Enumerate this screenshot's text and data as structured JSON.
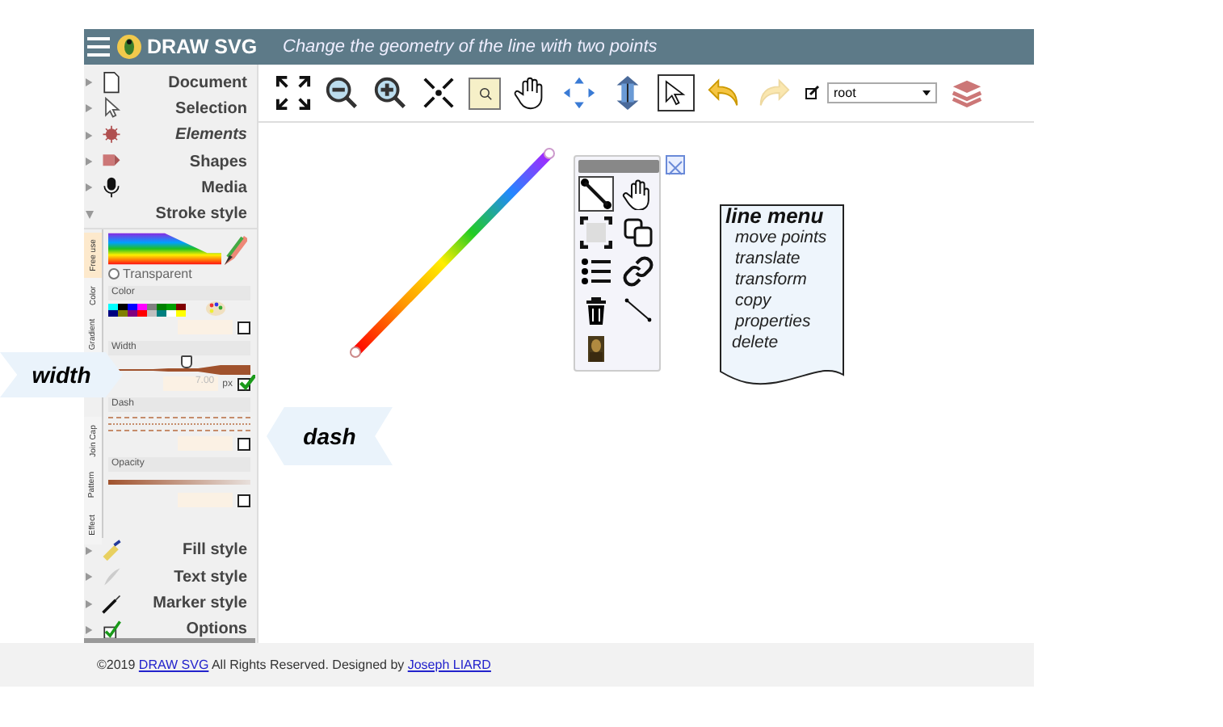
{
  "header": {
    "title": "DRAW SVG",
    "subtitle": "Change the geometry of the line with two points"
  },
  "sidebar": {
    "items": [
      {
        "label": "Document",
        "expanded": false,
        "emphasized": false
      },
      {
        "label": "Selection",
        "expanded": false,
        "emphasized": false
      },
      {
        "label": "Elements",
        "expanded": false,
        "emphasized": true
      },
      {
        "label": "Shapes",
        "expanded": false,
        "emphasized": false
      },
      {
        "label": "Media",
        "expanded": false,
        "emphasized": false
      },
      {
        "label": "Stroke style",
        "expanded": true,
        "emphasized": false
      },
      {
        "label": "Fill style",
        "expanded": false,
        "emphasized": false
      },
      {
        "label": "Text style",
        "expanded": false,
        "emphasized": false
      },
      {
        "label": "Marker style",
        "expanded": false,
        "emphasized": false
      },
      {
        "label": "Options",
        "expanded": false,
        "emphasized": false
      }
    ]
  },
  "stroke_panel": {
    "tabs": [
      {
        "label": "Free use",
        "selected": true
      },
      {
        "label": "Color",
        "selected": false
      },
      {
        "label": "Gradient",
        "selected": false
      },
      {
        "label": "Join Cap",
        "selected": false
      },
      {
        "label": "Pattern",
        "selected": false
      },
      {
        "label": "Effect",
        "selected": false
      }
    ],
    "transparent": {
      "label": "Transparent",
      "selected": false
    },
    "color": {
      "label": "Color",
      "checked": false,
      "swatches": [
        {
          "color": "#00ffff"
        },
        {
          "color": "#000000"
        },
        {
          "color": "#0000ff"
        },
        {
          "color": "#ff00ff"
        },
        {
          "color": "#808080"
        },
        {
          "color": "#008000"
        },
        {
          "color": "#00a000"
        },
        {
          "color": "#800000"
        },
        {
          "color": "#000080"
        },
        {
          "color": "#808000"
        },
        {
          "color": "#800080"
        },
        {
          "color": "#ff0000"
        },
        {
          "color": "#c0c0c0"
        },
        {
          "color": "#008080"
        },
        {
          "color": "#ffffff"
        },
        {
          "color": "#ffff00"
        }
      ]
    },
    "width": {
      "label": "Width",
      "level": 0.55,
      "value": "7.00",
      "unit": "px",
      "checked": true
    },
    "dash": {
      "label": "Dash",
      "checked": false
    },
    "opacity": {
      "label": "Opacity",
      "checked": false
    }
  },
  "toolbar": {
    "layer_select": {
      "value": "root"
    }
  },
  "tool_palette": {
    "tools": [
      {
        "selected": true
      },
      {
        "selected": false
      },
      {
        "selected": false
      },
      {
        "selected": false
      },
      {
        "selected": false
      },
      {
        "selected": false
      },
      {
        "selected": false
      },
      {
        "selected": false
      },
      {
        "selected": false
      }
    ]
  },
  "line_menu": {
    "title": "line menu",
    "items": [
      "move points",
      "translate",
      "transform",
      "copy",
      "properties",
      "delete"
    ]
  },
  "callouts": [
    {
      "label": "width",
      "kind": "right"
    },
    {
      "label": "dash",
      "kind": "left"
    }
  ],
  "footer": {
    "parts": [
      {
        "text": "©2019 ",
        "link": false
      },
      {
        "text": "DRAW SVG",
        "link": true
      },
      {
        "text": " All Rights Reserved. Designed by ",
        "link": false
      },
      {
        "text": "Joseph LIARD",
        "link": true
      }
    ]
  }
}
